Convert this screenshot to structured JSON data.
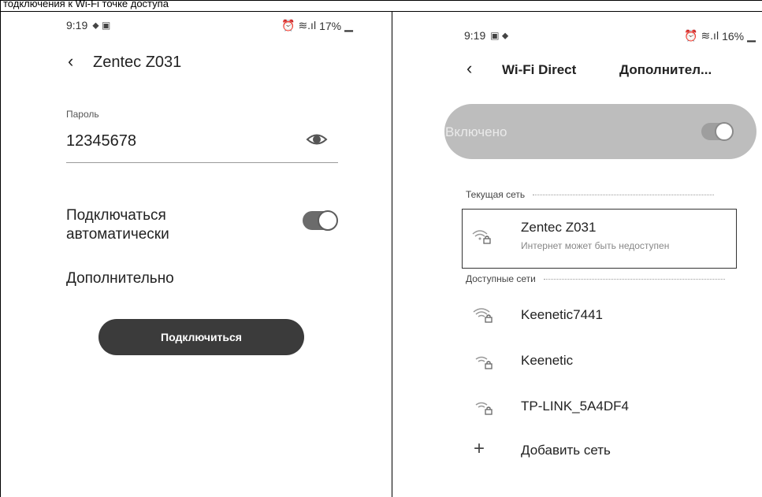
{
  "header_fragment": "тодключения к Wi-Fi точке доступа",
  "left_phone": {
    "status": {
      "time": "9:19",
      "battery": "17%"
    },
    "title": "Zentec Z031",
    "password_label": "Пароль",
    "password_value": "12345678",
    "auto_connect_label": "Подключаться автоматически",
    "auto_connect_on": true,
    "advanced_label": "Дополнительно",
    "connect_button": "Подключиться"
  },
  "right_phone": {
    "status": {
      "time": "9:19",
      "battery": "16%"
    },
    "title": "Wi-Fi Direct",
    "more": "Дополнител...",
    "enabled_label": "Включено",
    "enabled_on": true,
    "current_section": "Текущая сеть",
    "current_network": {
      "name": "Zentec Z031",
      "status": "Интернет может быть недоступен"
    },
    "available_section": "Доступные сети",
    "networks": [
      "Keenetic7441",
      "Keenetic",
      "TP-LINK_5A4DF4"
    ],
    "add_network": "Добавить сеть"
  },
  "colors": {
    "button": "#3b3b3b",
    "enabled_bar": "#bdbdbd",
    "toggle": "#6b6b6b"
  },
  "icons": [
    "back-chevron-icon",
    "eye-icon",
    "wifi-lock-icon",
    "plus-icon",
    "alarm-icon",
    "signal-icon",
    "battery-icon"
  ]
}
